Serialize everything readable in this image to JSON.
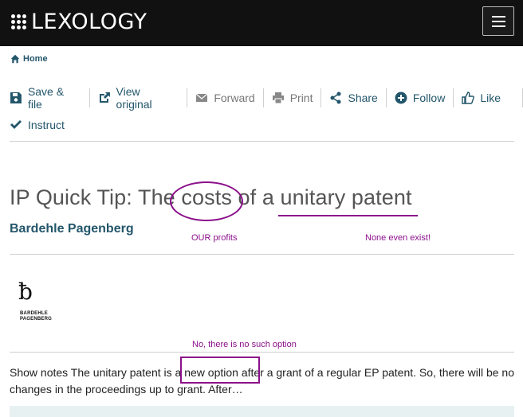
{
  "header": {
    "logo_text": "LEXOLOGY",
    "menu_icon": "hamburger-icon"
  },
  "breadcrumb": {
    "home_label": "Home",
    "icon": "home-icon"
  },
  "toolbar": {
    "save_file": "Save & file",
    "view_original": "View original",
    "forward": "Forward",
    "print": "Print",
    "share": "Share",
    "follow": "Follow",
    "like": "Like",
    "instruct": "Instruct"
  },
  "article": {
    "title": "IP Quick Tip: The costs of a unitary patent",
    "author": "Bardehle Pagenberg",
    "firm_logo_line1": "BARDEHLE",
    "firm_logo_line2": "PAGENBERG",
    "snippet": "Show notes The unitary patent is a new option after a grant of a regular EP patent. So, there will be no changes in the proceedings up to grant. After…"
  },
  "annotations": {
    "costs_note": "OUR profits",
    "unitary_note": "None even exist!",
    "option_note": "No, there is no such option",
    "color": "#8b108b"
  },
  "colors": {
    "link": "#23566b",
    "topbar": "#111111"
  }
}
